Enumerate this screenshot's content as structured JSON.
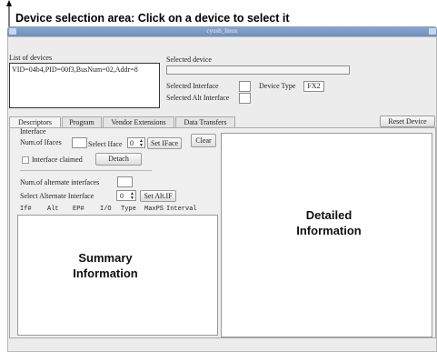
{
  "annotations": {
    "device_area": "Device selection area: Click on a device to select it",
    "summary": "Summary Information",
    "detailed": "Detailed Information"
  },
  "window": {
    "title": "cyusb_linux"
  },
  "device_list": {
    "label": "List of devices",
    "items": [
      "VID=04b4,PID=00f3,BusNum=02,Addr=8"
    ]
  },
  "selected": {
    "device_label": "Selected device",
    "interface_label": "Selected Interface",
    "device_type_label": "Device Type",
    "device_type_value": "FX2",
    "alt_interface_label": "Selected Alt Interface"
  },
  "tabs": [
    "Descriptors",
    "Program",
    "Vendor Extensions",
    "Data Transfers"
  ],
  "reset_button": "Reset Device",
  "interface_group": {
    "title": "Interface",
    "num_ifaces_label": "Num.of Ifaces",
    "select_iface_label": "Select Iface",
    "iface_value": "0",
    "set_iface_button": "Set IFace",
    "clear_button": "Clear",
    "claimed_label": "Interface claimed",
    "detach_button": "Detach",
    "num_alt_label": "Num.of alternate interfaces",
    "select_alt_label": "Select Alternate Interface",
    "alt_value": "0",
    "set_alt_button": "Set Alt.IF"
  },
  "endpoint_columns": [
    "If#",
    "Alt",
    "EP#",
    "I/O",
    "Type",
    "MaxPS",
    "Interval"
  ]
}
